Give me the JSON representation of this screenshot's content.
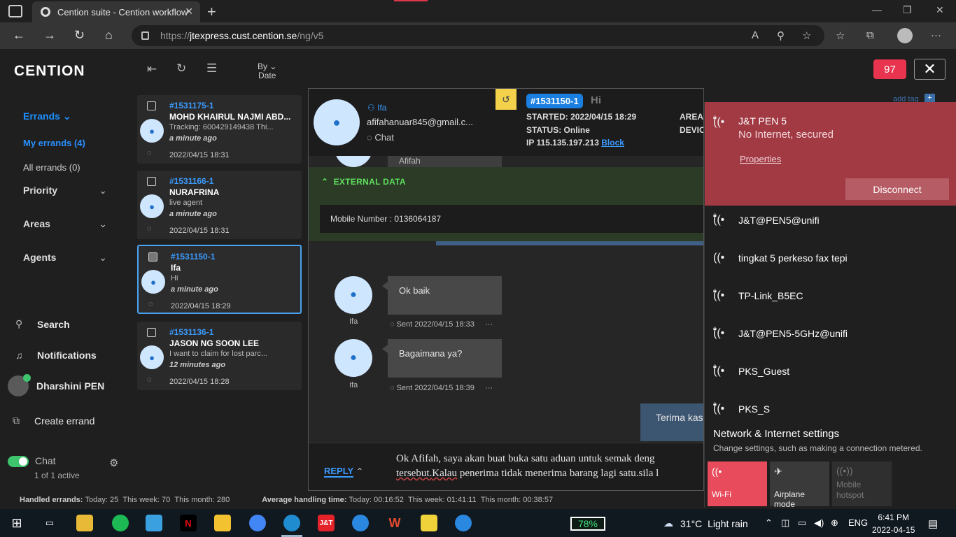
{
  "browser": {
    "tab_title": "Cention suite - Cention workflow",
    "tab_close": "✕",
    "new_tab": "+",
    "url_prefix": "https://",
    "url_host": "jtexpress.cust.cention.se",
    "url_path": "/ng/v5"
  },
  "app": {
    "logo": "CENTION",
    "badge_count": "97"
  },
  "sidebar": {
    "section": "Errands",
    "my_errands": "My errands (4)",
    "all_errands": "All errands (0)",
    "groups": [
      "Priority",
      "Areas",
      "Agents"
    ],
    "search": "Search",
    "notifications": "Notifications",
    "user": "Dharshini PEN",
    "create_errand": "Create errand",
    "chat_label": "Chat",
    "chat_active": "1 of 1 active"
  },
  "list_toolbar": {
    "sort_by": "By",
    "sort_value": "Date"
  },
  "errands": [
    {
      "id": "#1531175-1",
      "name": "MOHD KHAIRUL NAJMI ABD...",
      "preview": "Tracking: 600429149438 Thi...",
      "ago": "a minute ago",
      "date": "2022/04/15 18:31"
    },
    {
      "id": "#1531166-1",
      "name": "NURAFRINA",
      "preview": "live agent",
      "ago": "a minute ago",
      "date": "2022/04/15 18:31"
    },
    {
      "id": "#1531150-1",
      "name": "Ifa",
      "preview": "Hi",
      "ago": "a minute ago",
      "date": "2022/04/15 18:29"
    },
    {
      "id": "#1531136-1",
      "name": "JASON NG SOON LEE",
      "preview": "I want to claim for lost parc...",
      "ago": "12 minutes ago",
      "date": "2022/04/15 18:28"
    }
  ],
  "conversation": {
    "customer_name": "Ifa",
    "customer_email": "afifahanuar845@gmail.c...",
    "channel": "Chat",
    "errand_id": "#1531150-1",
    "subject": "Hi",
    "started": "STARTED: 2022/04/15 18:29",
    "status": "STATUS: Online",
    "ip": "IP 115.135.197.213",
    "block": "Block",
    "area": "AREA:",
    "device": "DEVIC",
    "add_tag": "add tag",
    "partial_agent": "Afifah",
    "external_title": "EXTERNAL DATA",
    "mobile": "Mobile Number : 0136064187",
    "messages": [
      {
        "sender": "Ifa",
        "text": "Ok baik",
        "sent": "Sent 2022/04/15 18:33",
        "more": "···"
      },
      {
        "sender": "Ifa",
        "text": "Bagaimana ya?",
        "sent": "Sent 2022/04/15 18:39",
        "more": "···"
      }
    ],
    "outgoing": "Terima kas",
    "reply_label": "REPLY",
    "reply_line1": "Ok Afifah, saya akan buat buka satu aduan untuk semak deng",
    "reply_line2a": "tersebut.",
    "reply_line2b": "Kalau",
    "reply_line2c": " penerima tidak menerima barang lagi satu.sila l"
  },
  "stats": {
    "handled_label": "Handled errands:",
    "handled_today": "Today: 25",
    "handled_week": "This week: 70",
    "handled_month": "This month: 280",
    "aht_label": "Average handling time:",
    "aht_today": "Today: 00:16:52",
    "aht_week": "This week: 01:41:11",
    "aht_month": "This month: 00:38:57"
  },
  "wifi": {
    "connected": {
      "name": "J&T PEN 5",
      "status": "No Internet, secured",
      "properties": "Properties",
      "disconnect": "Disconnect"
    },
    "networks": [
      "J&T@PEN5@unifi",
      "tingkat 5 perkeso fax tepi",
      "TP-Link_B5EC",
      "J&T@PEN5-5GHz@unifi",
      "PKS_Guest",
      "PKS_S"
    ],
    "settings_title": "Network & Internet settings",
    "settings_sub": "Change settings, such as making a connection metered.",
    "tiles": {
      "wifi": "Wi-Fi",
      "airplane": "Airplane mode",
      "hotspot_1": "Mobile",
      "hotspot_2": "hotspot"
    }
  },
  "taskbar": {
    "battery": "78%",
    "temperature": "31°C",
    "weather": "Light rain",
    "lang": "ENG",
    "time": "6:41 PM",
    "date": "2022-04-15"
  },
  "colors": {
    "accent": "#1e90ff",
    "badge": "#e8344e",
    "wifi_active": "#a23a44",
    "external_bg": "#2b3b26"
  }
}
